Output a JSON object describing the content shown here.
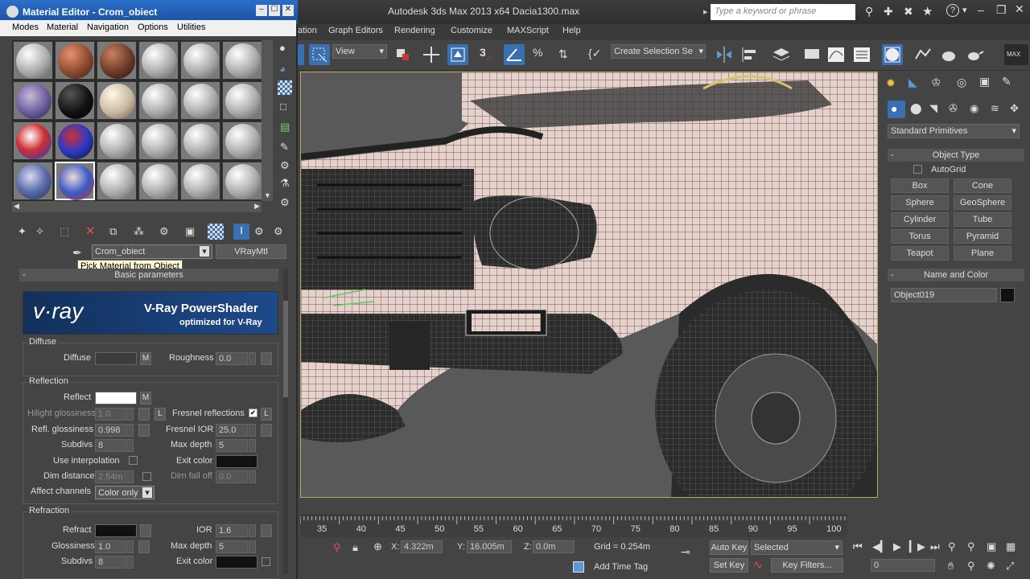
{
  "app": {
    "title": "Autodesk 3ds Max  2013 x64      Dacia1300.max",
    "search_placeholder": "Type a keyword or phrase",
    "menu": [
      "ation",
      "Graph Editors",
      "Rendering",
      "Customize",
      "MAXScript",
      "Help"
    ],
    "view_dropdown": "View",
    "selection_set": "Create Selection Se",
    "toolbar_snap": "3"
  },
  "mated": {
    "title": "Material Editor - Crom_obiect",
    "menu": [
      "Modes",
      "Material",
      "Navigation",
      "Options",
      "Utilities"
    ],
    "material_name": "Crom_obiect",
    "material_type": "VRayMtl",
    "tooltip": "Pick Material from Object",
    "rollout_basic": "Basic parameters",
    "vray_logo": "v·ray",
    "banner_title": "V-Ray PowerShader",
    "banner_sub": "optimized for V-Ray",
    "diffuse": {
      "group": "Diffuse",
      "diffuse_label": "Diffuse",
      "m": "M",
      "roughness_label": "Roughness",
      "roughness_value": "0.0"
    },
    "reflection": {
      "group": "Reflection",
      "reflect_label": "Reflect",
      "m": "M",
      "hilight_label": "Hilight glossiness",
      "hilight_value": "1.0",
      "l": "L",
      "fresnel_label": "Fresnel reflections",
      "refl_gloss_label": "Refl. glossiness",
      "refl_gloss_value": "0.998",
      "fresnel_ior_label": "Fresnel IOR",
      "fresnel_ior_value": "25.0",
      "subdivs_label": "Subdivs",
      "subdivs_value": "8",
      "max_depth_label": "Max depth",
      "max_depth_value": "5",
      "use_interp_label": "Use interpolation",
      "exit_color_label": "Exit color",
      "dim_dist_label": "Dim distance",
      "dim_dist_value": "2.54m",
      "dim_fall_label": "Dim fall off",
      "dim_fall_value": "0.0",
      "affect_label": "Affect channels",
      "affect_value": "Color only"
    },
    "refraction": {
      "group": "Refraction",
      "refract_label": "Refract",
      "ior_label": "IOR",
      "ior_value": "1.6",
      "gloss_label": "Glossiness",
      "gloss_value": "1.0",
      "max_depth_label": "Max depth",
      "max_depth_value": "5",
      "subdivs_label": "Subdivs",
      "subdivs_value": "8",
      "exit_color_label": "Exit color"
    }
  },
  "cmd": {
    "dropdown": "Standard Primitives",
    "object_type": "Object Type",
    "autogrid": "AutoGrid",
    "primitives": [
      "Box",
      "Cone",
      "Sphere",
      "GeoSphere",
      "Cylinder",
      "Tube",
      "Torus",
      "Pyramid",
      "Teapot",
      "Plane"
    ],
    "name_color": "Name and Color",
    "object_name": "Object019"
  },
  "timeline": {
    "ticks": [
      "35",
      "40",
      "45",
      "50",
      "55",
      "60",
      "65",
      "70",
      "75",
      "80",
      "85",
      "90",
      "95",
      "100"
    ]
  },
  "status": {
    "x_label": "X:",
    "x_value": "4.322m",
    "y_label": "Y:",
    "y_value": "16.005m",
    "z_label": "Z:",
    "z_value": "0.0m",
    "grid": "Grid = 0.254m",
    "add_time_tag": "Add Time Tag",
    "auto_key": "Auto Key",
    "selected": "Selected",
    "set_key": "Set Key",
    "key_filters": "Key Filters...",
    "frame": "0"
  },
  "colors": {
    "accent": "#2a6fc8",
    "panel": "#444444",
    "viewport": "#5a5a5a"
  }
}
